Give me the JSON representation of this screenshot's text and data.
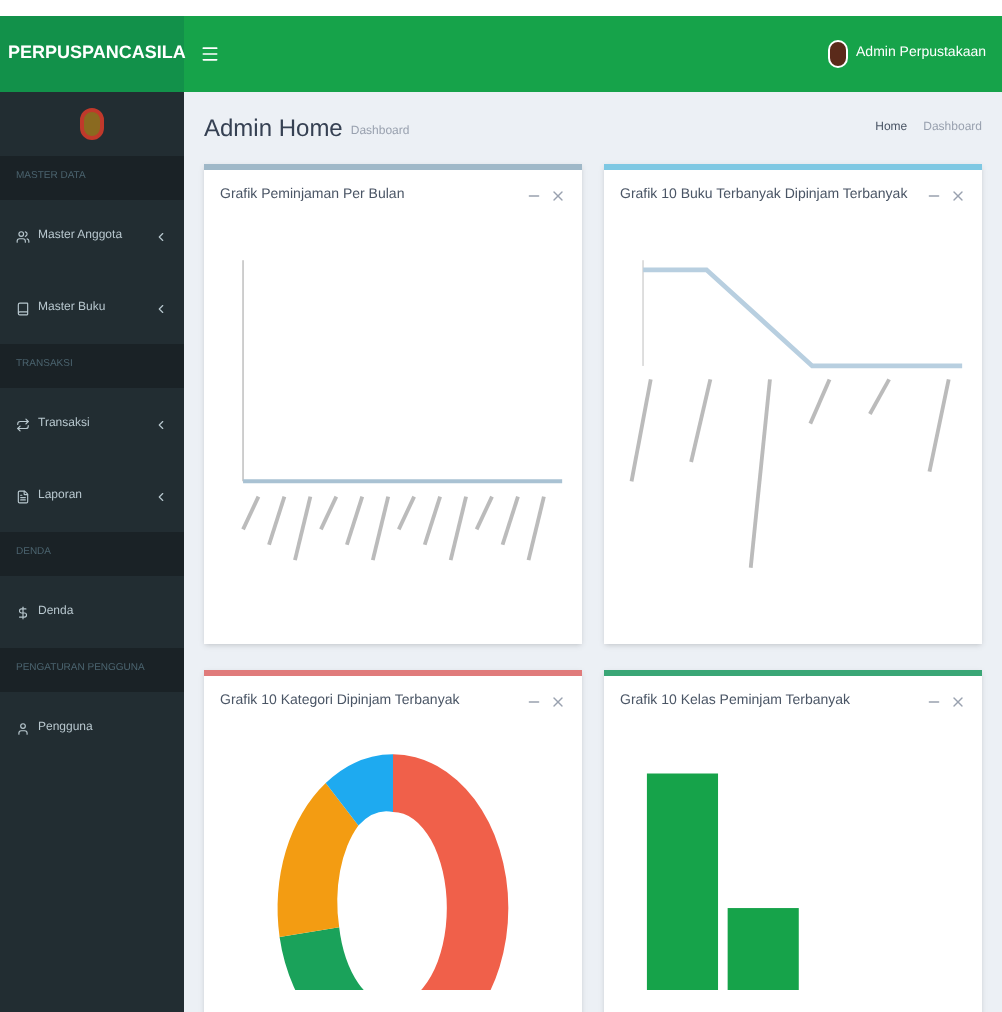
{
  "brand": "PERPUSPANCASILA",
  "user": {
    "name": "Admin Perpustakaan"
  },
  "sidebar": {
    "sections": [
      {
        "header": "MASTER DATA",
        "items": [
          {
            "label": "Master Anggota",
            "expandable": true
          },
          {
            "label": "Master Buku",
            "expandable": true
          }
        ]
      },
      {
        "header": "TRANSAKSI",
        "items": [
          {
            "label": "Transaksi",
            "expandable": true
          },
          {
            "label": "Laporan",
            "expandable": true
          }
        ]
      },
      {
        "header": "DENDA",
        "items": [
          {
            "label": "Denda",
            "expandable": false
          }
        ]
      },
      {
        "header": "PENGATURAN PENGGUNA",
        "items": [
          {
            "label": "Pengguna",
            "expandable": false
          }
        ]
      }
    ]
  },
  "page": {
    "title": "Admin Home",
    "subtitle": "Dashboard",
    "breadcrumb": [
      "Home",
      "Dashboard"
    ]
  },
  "cards": [
    {
      "title": "Grafik Peminjaman Per Bulan",
      "color": "#9fb8c8",
      "kind": "flat-line"
    },
    {
      "title": "Grafik 10 Buku Terbanyak Dipinjam Terbanyak",
      "color": "#7ec8e3",
      "kind": "line"
    },
    {
      "title": "Grafik 10 Kategori Dipinjam Terbanyak",
      "color": "#e07b7b",
      "kind": "donut"
    },
    {
      "title": "Grafik 10 Kelas Peminjam Terbanyak",
      "color": "#3aa676",
      "kind": "bar"
    }
  ]
}
